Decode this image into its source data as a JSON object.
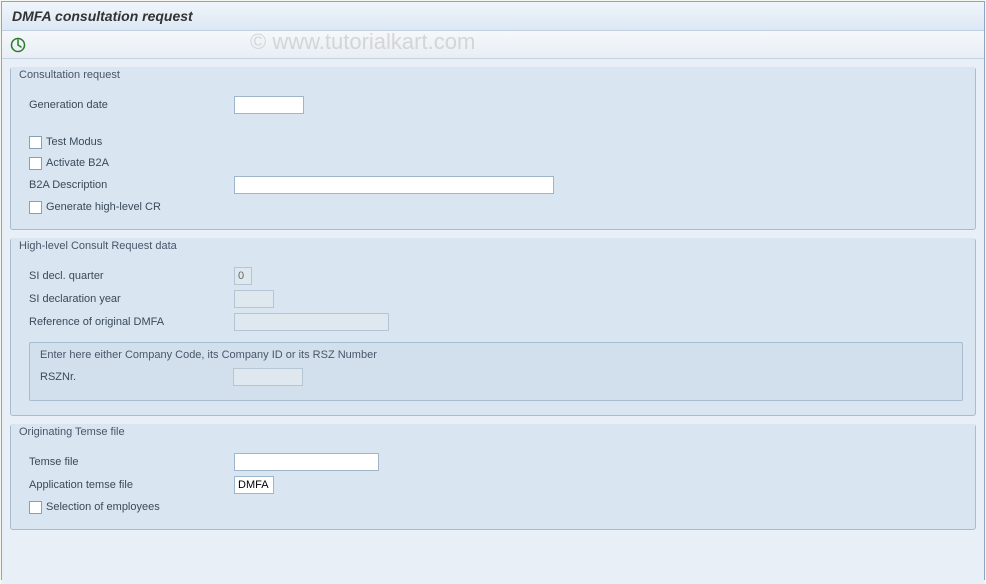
{
  "window": {
    "title": "DMFA consultation request"
  },
  "watermark": "© www.tutorialkart.com",
  "groups": {
    "consult": {
      "title": "Consultation request",
      "gen_date_label": "Generation date",
      "gen_date_value": "",
      "test_modus_label": "Test Modus",
      "activate_b2a_label": "Activate B2A",
      "b2a_desc_label": "B2A Description",
      "b2a_desc_value": "",
      "gen_high_cr_label": "Generate high-level CR"
    },
    "highlevel": {
      "title": "High-level Consult Request data",
      "si_quarter_label": "SI decl. quarter",
      "si_quarter_value": "0",
      "si_year_label": "SI declaration year",
      "si_year_value": "",
      "ref_dmfa_label": "Reference of original DMFA",
      "ref_dmfa_value": "",
      "nested_title": "Enter here either Company Code, its Company ID or its RSZ Number",
      "rsznr_label": "RSZNr.",
      "rsznr_value": ""
    },
    "temse": {
      "title": "Originating Temse file",
      "temse_file_label": "Temse file",
      "temse_file_value": "",
      "app_temse_label": "Application temse file",
      "app_temse_value": "DMFA",
      "sel_emp_label": "Selection of employees"
    }
  }
}
